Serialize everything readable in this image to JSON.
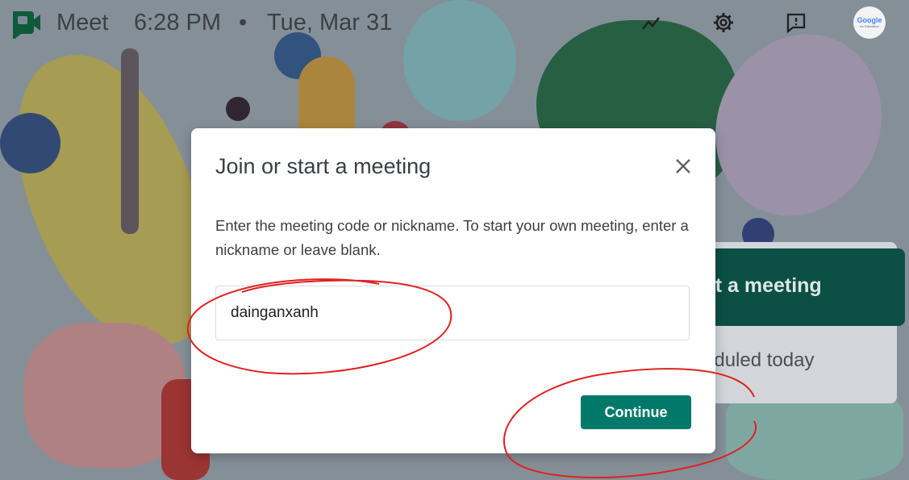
{
  "header": {
    "app_name": "Meet",
    "time": "6:28 PM",
    "separator": "•",
    "date": "Tue, Mar 31",
    "icons": [
      "meet-logo-icon",
      "trending-icon",
      "settings-icon",
      "feedback-icon"
    ],
    "gfe_logo_text": "Google",
    "gfe_logo_sub": "for Education"
  },
  "background_panel": {
    "start_meeting_label": "rt a meeting",
    "scheduled_label": "eduled today"
  },
  "dialog": {
    "title": "Join or start a meeting",
    "description": "Enter the meeting code or nickname. To start your own meeting, enter a nickname or leave blank.",
    "input_value": "dainganxanh",
    "continue_label": "Continue",
    "close_icon": "close-icon"
  },
  "colors": {
    "accent": "#00796b",
    "annotation": "#e02020",
    "start_button": "#0b4f45"
  }
}
